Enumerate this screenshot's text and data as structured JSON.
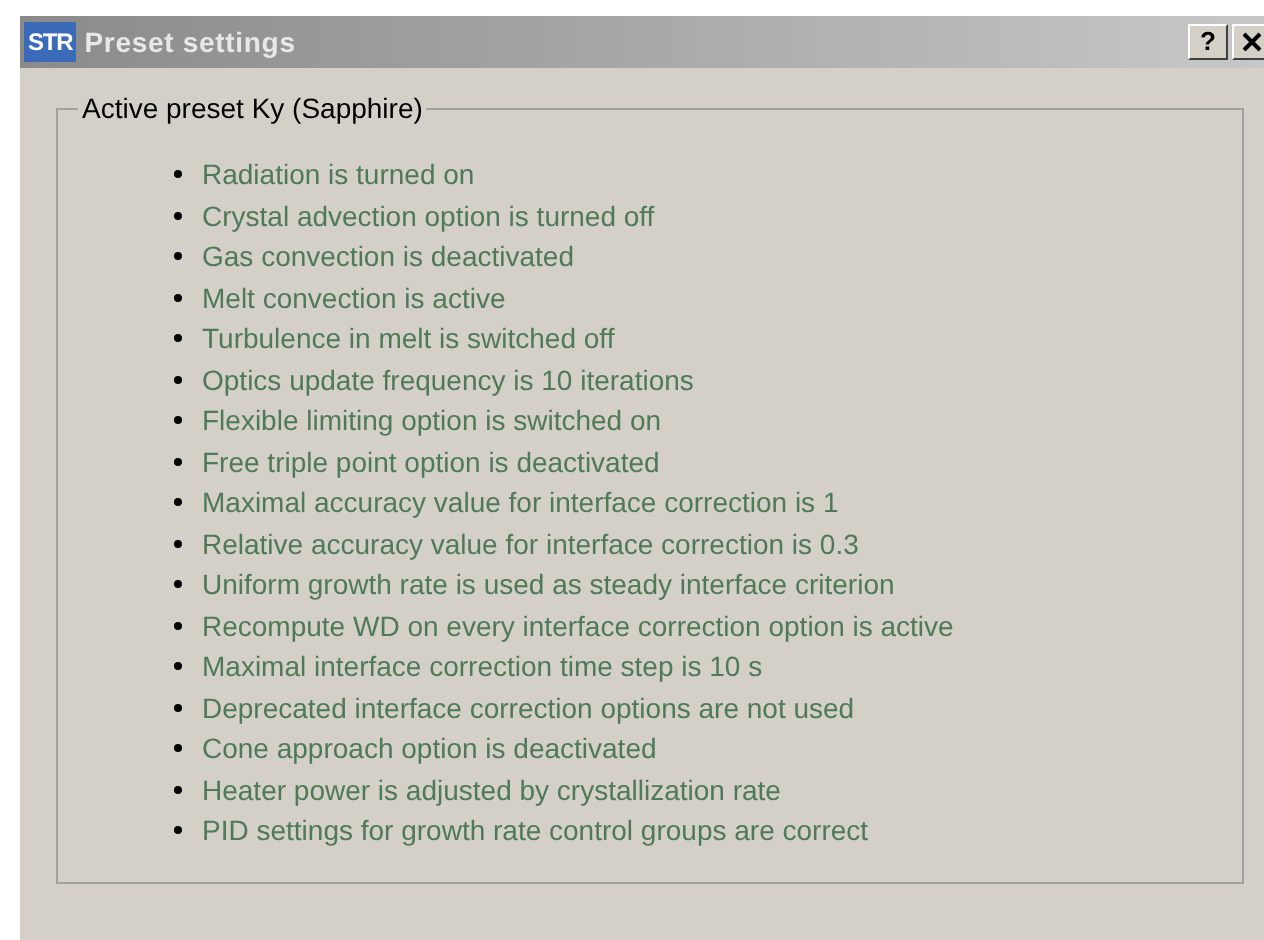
{
  "window": {
    "icon_text": "STR",
    "title": "Preset settings",
    "help_button": "?"
  },
  "group": {
    "title": "Active preset Ky (Sapphire)",
    "items": [
      "Radiation is turned on",
      "Crystal advection option is turned off",
      "Gas convection is deactivated",
      "Melt convection is active",
      "Turbulence in melt is switched off",
      "Optics update frequency is 10 iterations",
      "Flexible limiting option is switched on",
      "Free triple point option is deactivated",
      "Maximal accuracy value for interface correction is 1",
      "Relative accuracy value for interface correction is 0.3",
      "Uniform growth rate is used as steady interface criterion",
      "Recompute WD on every interface correction option is active",
      "Maximal interface correction time step is 10 s",
      "Deprecated interface correction options are not used",
      "Cone approach option is deactivated",
      "Heater power is adjusted by crystallization rate",
      "PID settings for growth rate control groups are correct"
    ]
  }
}
